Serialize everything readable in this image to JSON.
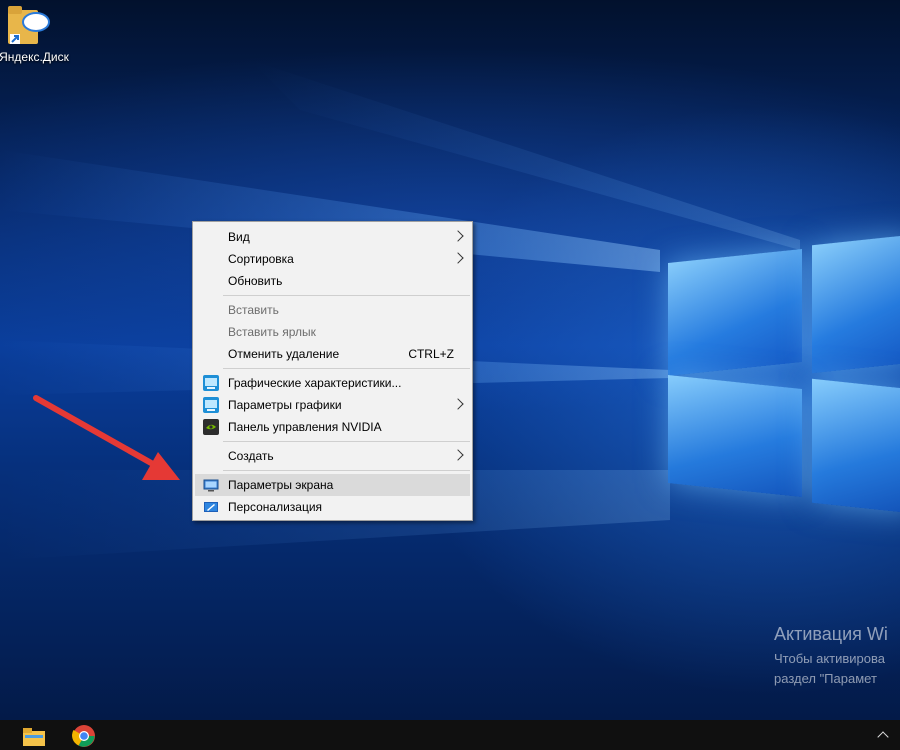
{
  "desktop": {
    "icons": [
      {
        "label": "Яндекс.Диск",
        "icon": "yandex-disk-icon"
      }
    ]
  },
  "context_menu": {
    "items": [
      {
        "label": "Вид",
        "submenu": true
      },
      {
        "label": "Сортировка",
        "submenu": true
      },
      {
        "label": "Обновить"
      },
      {
        "label": "Вставить",
        "disabled": true
      },
      {
        "label": "Вставить ярлык",
        "disabled": true
      },
      {
        "label": "Отменить удаление",
        "shortcut": "CTRL+Z"
      },
      {
        "label": "Графические характеристики...",
        "icon": "intel-graphics-icon"
      },
      {
        "label": "Параметры графики",
        "icon": "intel-graphics-icon",
        "submenu": true
      },
      {
        "label": "Панель управления NVIDIA",
        "icon": "nvidia-icon"
      },
      {
        "label": "Создать",
        "submenu": true
      },
      {
        "label": "Параметры экрана",
        "icon": "display-settings-icon",
        "highlighted": true
      },
      {
        "label": "Персонализация",
        "icon": "personalization-icon"
      }
    ]
  },
  "activation": {
    "title": "Активация Wi",
    "line1": "Чтобы активирова",
    "line2": "раздел \"Парамет"
  },
  "taskbar": {
    "apps": [
      {
        "icon": "file-explorer-icon"
      },
      {
        "icon": "chrome-icon"
      }
    ],
    "tray": {
      "icon": "chevron-up-icon"
    }
  },
  "colors": {
    "menu_bg": "#f2f2f2",
    "highlight": "#dadada",
    "accent_arrow": "#e53935",
    "taskbar": "#101010"
  }
}
